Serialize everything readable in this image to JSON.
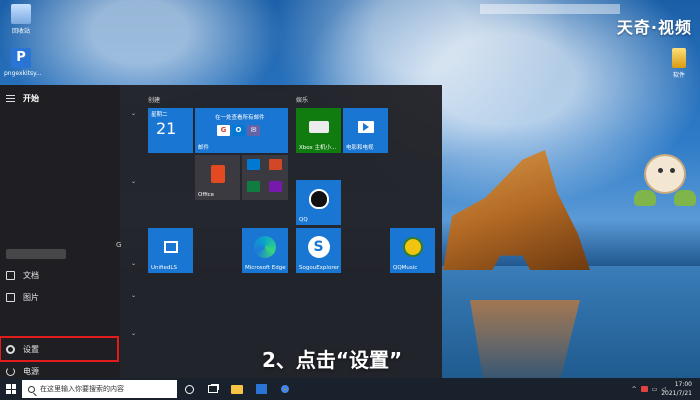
{
  "desktop": {
    "icons": [
      {
        "label": "回收站"
      },
      {
        "label": "P",
        "sublabel": "pngexkitsy..."
      },
      {
        "label": "软件"
      }
    ],
    "watermark": "天奇·视频"
  },
  "start_menu": {
    "header": "开始",
    "side_char": "G",
    "rail_items": [
      {
        "label": "文档",
        "icon": "document-icon"
      },
      {
        "label": "图片",
        "icon": "pictures-icon"
      },
      {
        "label": "设置",
        "icon": "settings-gear-icon"
      },
      {
        "label": "电源",
        "icon": "power-icon"
      }
    ],
    "groups": {
      "create": "创建",
      "play": "娱乐"
    },
    "tiles": {
      "calendar": {
        "weekday": "星期二",
        "day": "21"
      },
      "mail": {
        "top": "在一处查看所有邮件",
        "label": "邮件"
      },
      "office": {
        "label": "Office"
      },
      "xbox": {
        "label": "Xbox 主机小..."
      },
      "movies": {
        "label": "电影和电视"
      },
      "qq": {
        "label": "QQ"
      },
      "unified": {
        "label": "UnifiedLS"
      },
      "edge": {
        "label": "Microsoft Edge"
      },
      "sogou": {
        "label": "SogouExplorer"
      },
      "qqmusic": {
        "label": "QQMusic"
      }
    }
  },
  "caption": "2、点击“设置”",
  "taskbar": {
    "search_placeholder": "在这里输入你要搜索的内容",
    "time": "17:00",
    "date": "2021/7/21"
  }
}
